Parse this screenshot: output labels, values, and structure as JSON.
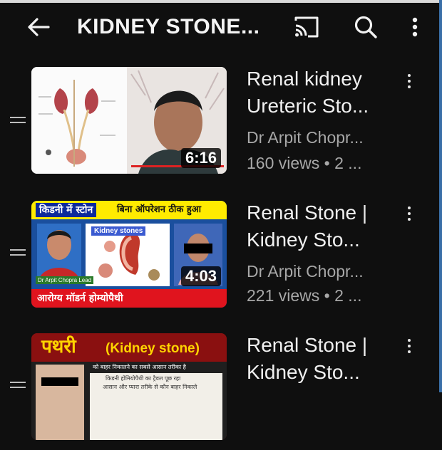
{
  "header": {
    "title": "KIDNEY STONE...",
    "icons": [
      "back-arrow-icon",
      "cast-icon",
      "search-icon",
      "more-vert-icon"
    ]
  },
  "colors": {
    "background": "#0f0f0f",
    "primary_text": "#f1f1f1",
    "secondary_text": "#a8a8a8"
  },
  "videos": [
    {
      "title_line1": "Renal kidney",
      "title_line2": "Ureteric Sto...",
      "channel": "Dr Arpit Chopr...",
      "views": "160 views • 2 ...",
      "duration": "6:16"
    },
    {
      "title_line1": "Renal Stone |",
      "title_line2": "Kidney Sto...",
      "channel": "Dr Arpit Chopr...",
      "views": "221 views • 2 ...",
      "duration": "4:03",
      "thumb_banner_left": "किडनी में स्टोन",
      "thumb_banner_right": "बिना ऑपरेशन ठीक हुआ",
      "thumb_panel_label": "Kidney stones",
      "thumb_doctor_label": "Dr Arpit Chopra Lead",
      "thumb_footer": "आरोग्य मॉडर्न होम्योपैथी"
    },
    {
      "title_line1": "Renal Stone |",
      "title_line2": "Kidney Sto...",
      "thumb_heading_hindi": "पथरी",
      "thumb_heading_en": "(Kidney stone)",
      "thumb_sub1": "को बाहर निकालने का सबसे आसान तरीका है",
      "thumb_sub2": "किडनी होमियोपैथी का ट्रैवल पूछ रहा",
      "thumb_sub3": "आसान और प्यारा तरीके से कौन बाहर निकाले"
    }
  ]
}
